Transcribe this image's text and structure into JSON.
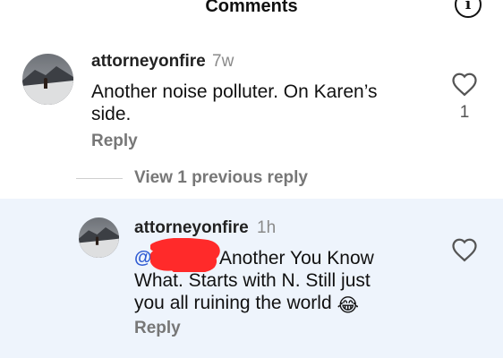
{
  "header": {
    "title": "Comments",
    "info_icon": "info-icon",
    "info_glyph": "i"
  },
  "comments": [
    {
      "username": "attorneyonfire",
      "time": "7w",
      "text_lines": [
        "Another noise polluter. On Karen’s",
        "side."
      ],
      "reply_label": "Reply",
      "likes": "1",
      "avatar_icon": "avatar"
    }
  ],
  "thread": {
    "view_replies_label": "View 1 previous reply"
  },
  "reply": {
    "username": "attorneyonfire",
    "time": "1h",
    "mention_glyph": "@",
    "text_line1": "Another You Know",
    "text_line2": "What. Starts with N. Still just",
    "text_line3": "you all ruining the world",
    "emoji": "😂",
    "reply_label": "Reply",
    "highlight_color": "#eef4fc"
  }
}
